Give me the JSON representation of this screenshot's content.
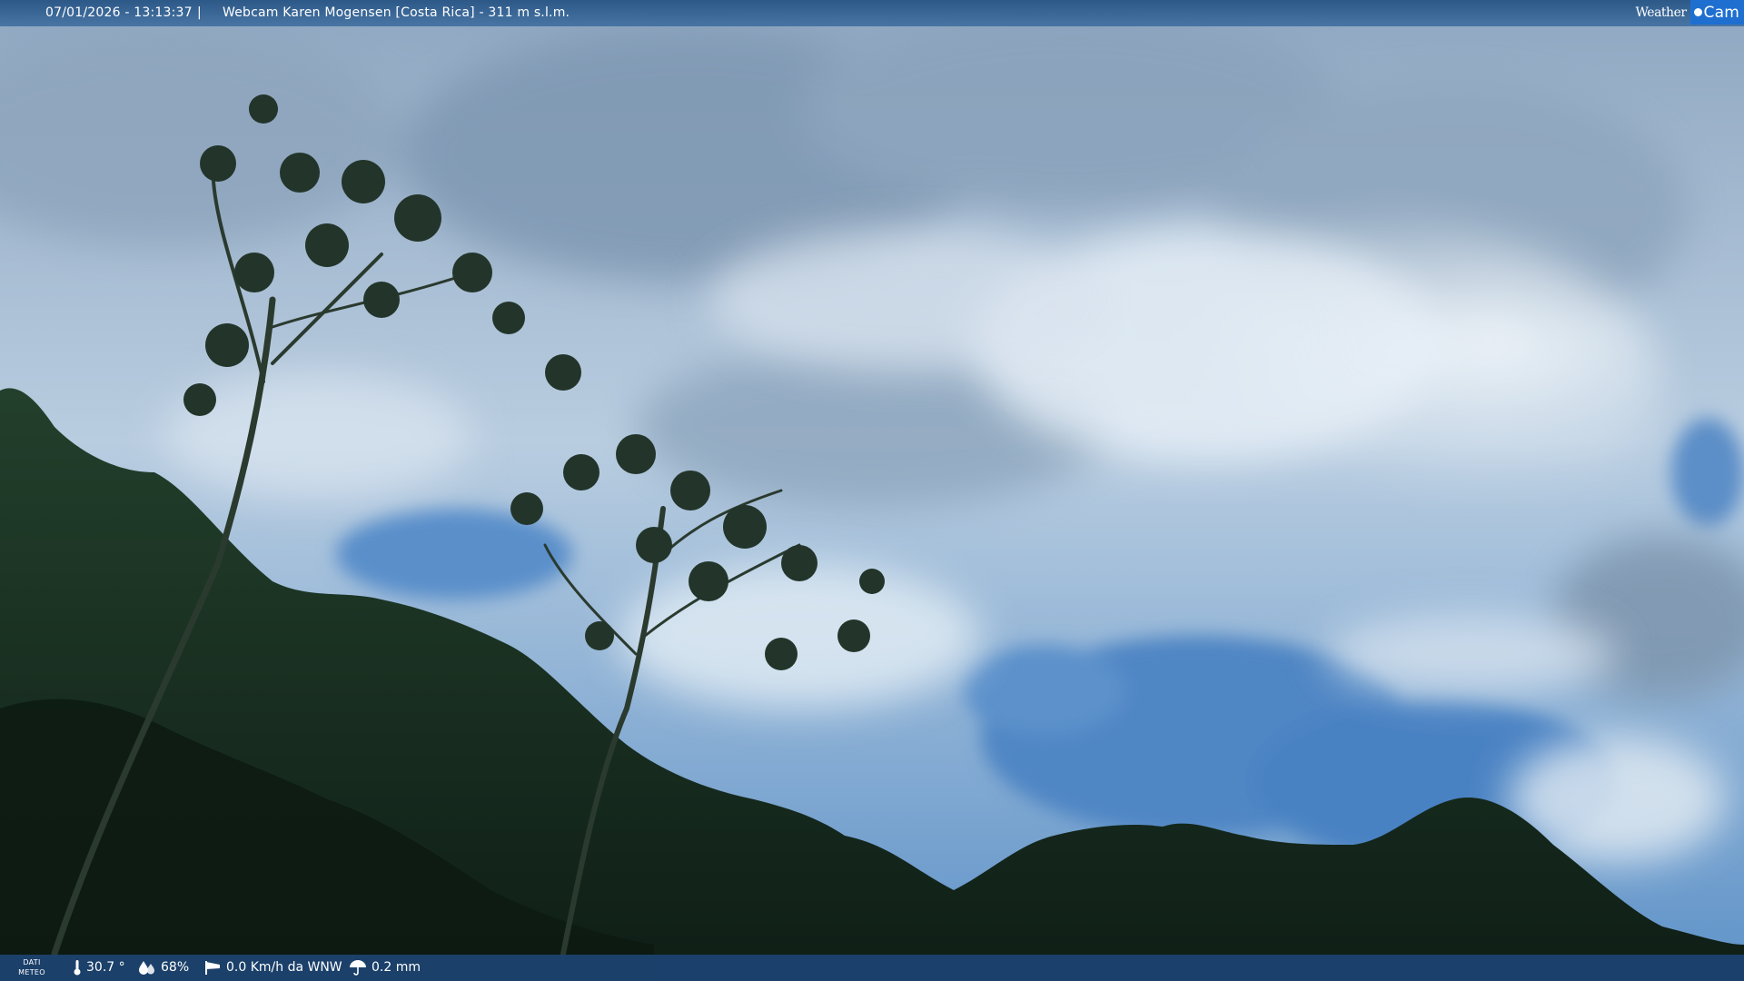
{
  "header": {
    "datetime": "07/01/2026 - 13:13:37",
    "separator": "|",
    "title": "Webcam Karen Mogensen [Costa Rica] - 311 m s.l.m.",
    "logo_weather": "Weather",
    "logo_cam": "Cam"
  },
  "footer": {
    "dati_line1": "DATI",
    "dati_line2": "METEO",
    "temperature": "30.7 °",
    "humidity": "68%",
    "wind": "0.0 Km/h da WNW",
    "rain": "0.2 mm"
  },
  "icons": {
    "temperature": "thermometer-icon",
    "humidity": "humidity-drops-icon",
    "wind": "wind-sock-icon",
    "rain": "umbrella-icon"
  },
  "colors": {
    "bar": "#1c4270",
    "logo_accent": "#1e6fd0",
    "sky": "#4d7fb6"
  }
}
